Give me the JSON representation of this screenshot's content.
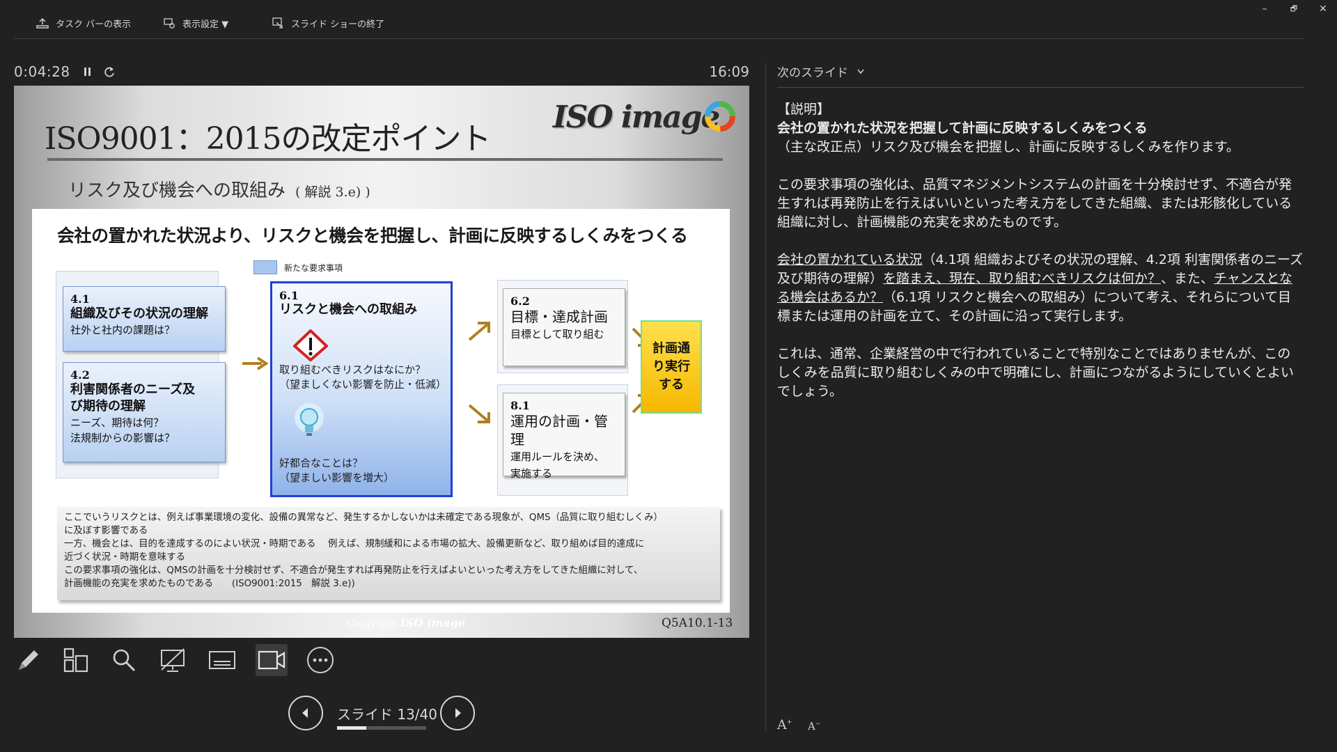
{
  "toolbar": {
    "taskbar_label": "タスク バーの表示",
    "display_settings_label": "表示設定 ▼",
    "end_show_label": "スライド ショーの終了"
  },
  "window_controls": {
    "minimize": "–",
    "restore": "🗗",
    "close": "✕"
  },
  "presenter": {
    "elapsed": "0:04:28",
    "clock": "16:09"
  },
  "slide": {
    "title": "ISO9001：2015の改定ポイント",
    "subtitle": "リスク及び機会への取組み",
    "subtitle_note": "( 解説 3.e) )",
    "logo_text": "ISO image",
    "headline": "会社の置かれた状況より、リスクと機会を把握し、計画に反映するしくみをつくる",
    "legend": "新たな要求事項",
    "box41": {
      "num": "4.1",
      "title": "組織及びその状況の理解",
      "sub": "社外と社内の課題は？"
    },
    "box42": {
      "num": "4.2",
      "title_1": "利害関係者のニーズ及",
      "title_2": "び期待の理解",
      "sub_1": "ニーズ、期待は何？",
      "sub_2": "法規制からの影響は？"
    },
    "box61": {
      "num": "6.1",
      "title": "リスクと機会への取組み",
      "risk_q": "取り組むべきリスクはなにか？",
      "risk_note": "（望ましくない影響を防止・低減）",
      "opp_q": "好都合なことは？",
      "opp_note": "（望ましい影響を増大）"
    },
    "box62": {
      "num": "6.2",
      "title": "目標・達成計画",
      "sub": "目標として取り組む"
    },
    "box81": {
      "num": "8.1",
      "title": "運用の計画・管理",
      "sub_1": "運用ルールを決め、",
      "sub_2": "実施する"
    },
    "result": {
      "line1": "計画通",
      "line2": "り実行",
      "line3": "する"
    },
    "note_lines": [
      "ここでいうリスクとは、例えば事業環境の変化、設備の異常など、発生するかしないかは未確定である現象が、QMS（品質に取り組むしくみ）",
      "に及ぼす影響である",
      "一方、機会とは、目的を達成するのによい状況・時期である　 例えば、規制緩和による市場の拡大、設備更新など、取り組めば目的達成に",
      "近づく状況・時期を意味する",
      "この要求事項の強化は、QMSの計画を十分検討せず、不適合が発生すれば再発防止を行えばよいといった考え方をしてきた組織に対して、",
      "計画機能の充実を求めたものである　　(ISO9001:2015　解説 3.e))"
    ],
    "copyright": "Copyright",
    "copyright_logo": "ISO image",
    "code": "Q5A10.1-13"
  },
  "navigation": {
    "slide_counter": "スライド 13/40",
    "progress": 0.325
  },
  "notes_panel": {
    "next_slide_label": "次のスライド",
    "heading": "【説明】",
    "bold_line": "会社の置かれた状況を把握して計画に反映するしくみをつくる",
    "line1": "（主な改正点）リスク及び機会を把握し、計画に反映するしくみを作ります。",
    "para2": "この要求事項の強化は、品質マネジメントシステムの計画を十分検討せず、不適合が発生すれば再発防止を行えばいいといった考え方をしてきた組織、または形骸化している組織に対し、計画機能の充実を求めたものです。",
    "p3_u1": "会社の置かれている状況",
    "p3_t1": "（4.1項 組織およびその状況の理解、4.2項 利害関係者のニーズ及び期待の理解）",
    "p3_u2": "を踏まえ、現在、取り組むべきリスクは何か？",
    "p3_t2": "、また、",
    "p3_u3": "チャンスとなる機会はあるか？",
    "p3_t3": "（6.1項 リスクと機会への取組み）について考え、それらについて目標または運用の計画を立て、その計画に沿って実行します。",
    "para4": "これは、通常、企業経営の中で行われていることで特別なことではありませんが、このしくみを品質に取り組むしくみの中で明確にし、計画につながるようにしていくとよいでしょう。",
    "font_up": "A",
    "font_down": "A"
  }
}
